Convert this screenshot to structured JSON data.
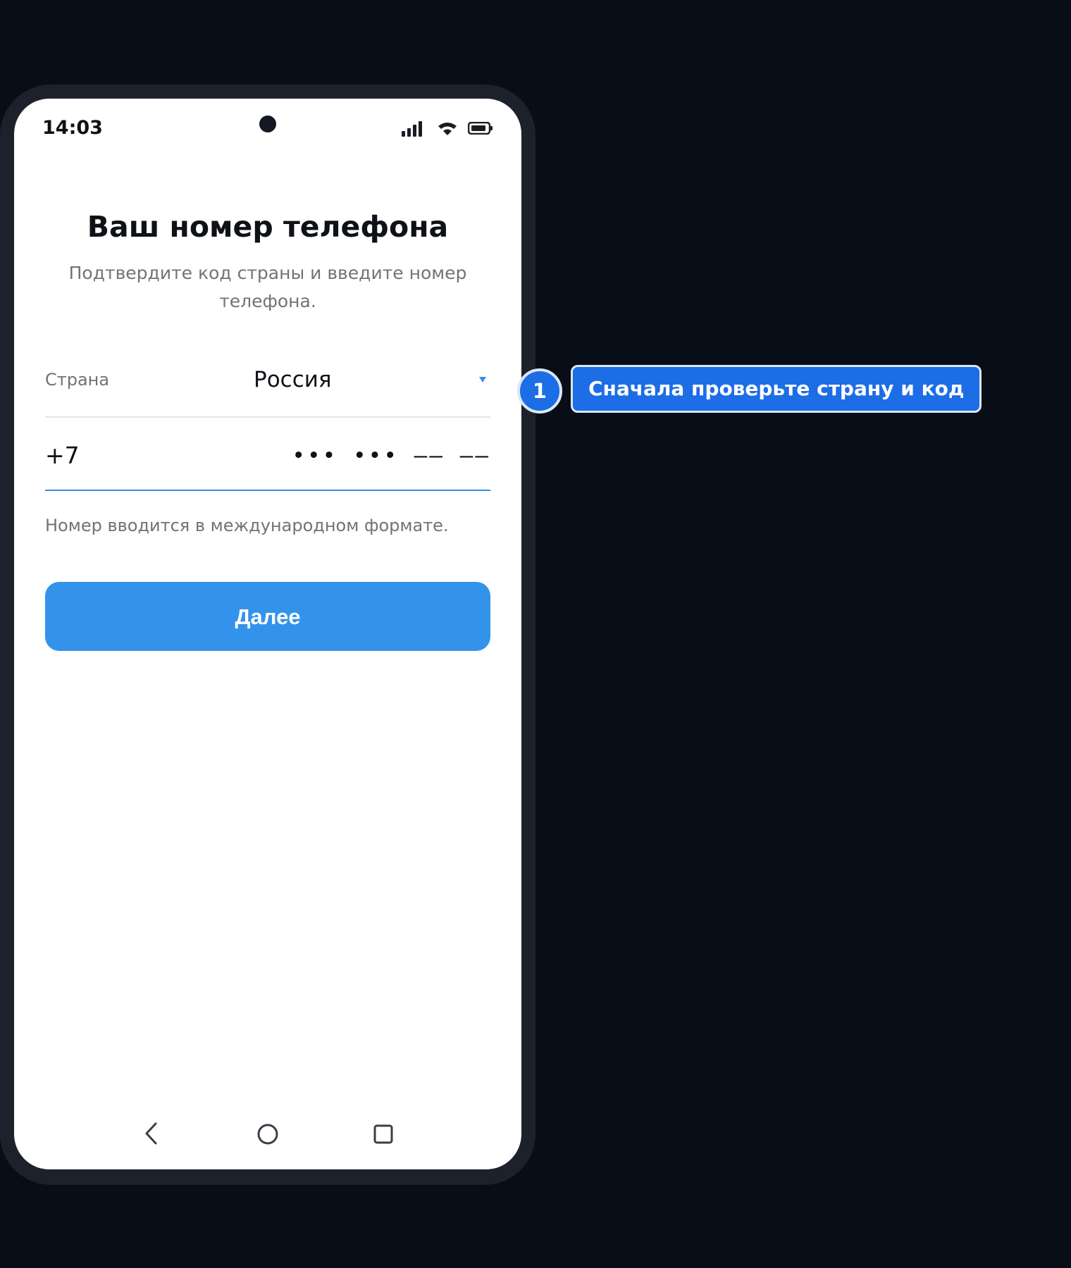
{
  "status_bar": {
    "time": "14:03",
    "icons": [
      "signal-icon",
      "wifi-icon",
      "battery-icon"
    ]
  },
  "screen": {
    "title": "Ваш номер телефона",
    "subtitle": "Подтвердите код страны и введите номер телефона.",
    "country": {
      "label": "Страна",
      "value": "Россия"
    },
    "phone": {
      "code": "+7",
      "placeholder": "••• ••• –– ––"
    },
    "hint": "Номер вводится в международном формате.",
    "next_button": "Далее"
  },
  "nav_bar": {
    "icons": [
      "back-icon",
      "home-icon",
      "recent-apps-icon"
    ]
  },
  "annotation": {
    "step_number": "1",
    "text": "Сначала проверьте страну и код"
  },
  "colors": {
    "background": "#090d16",
    "phone_frame": "#1d212b",
    "accent": "#3393ea",
    "callout": "#1c6de6",
    "active_underline": "#3a8bde"
  }
}
